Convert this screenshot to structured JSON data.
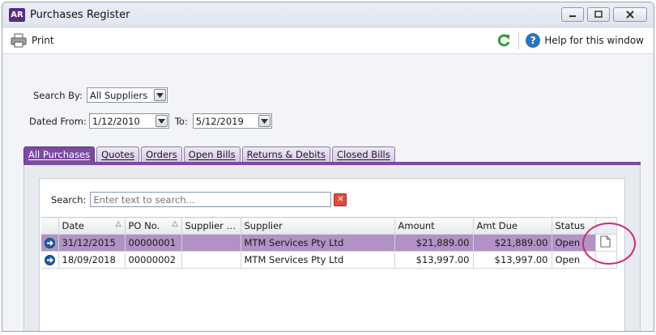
{
  "window": {
    "logo": "AR",
    "title": "Purchases Register"
  },
  "toolbar": {
    "print_label": "Print",
    "help_label": "Help for this window"
  },
  "filters": {
    "search_by_label": "Search By:",
    "search_by_value": "All Suppliers",
    "dated_from_label": "Dated From:",
    "dated_from_value": "1/12/2010",
    "to_label": "To:",
    "to_value": "5/12/2019"
  },
  "tabs": [
    {
      "label": "All Purchases",
      "active": true
    },
    {
      "label": "Quotes"
    },
    {
      "label": "Orders"
    },
    {
      "label": "Open Bills"
    },
    {
      "label": "Returns & Debits"
    },
    {
      "label": "Closed Bills"
    }
  ],
  "search": {
    "label": "Search:",
    "placeholder": "Enter text to search..."
  },
  "table": {
    "columns": [
      "Date",
      "PO No.",
      "Supplier I...",
      "Supplier",
      "Amount",
      "Amt Due",
      "Status"
    ],
    "rows": [
      {
        "date": "31/12/2015",
        "po": "00000001",
        "supplier_inv": "",
        "supplier": "MTM Services Pty Ltd",
        "amount": "$21,889.00",
        "amt_due": "$21,889.00",
        "status": "Open",
        "selected": true
      },
      {
        "date": "18/09/2018",
        "po": "00000002",
        "supplier_inv": "",
        "supplier": "MTM Services Pty Ltd",
        "amount": "$13,997.00",
        "amt_due": "$13,997.00",
        "status": "Open",
        "selected": false
      }
    ]
  },
  "colors": {
    "accent": "#7b4aa3",
    "selected_row": "#b093c4",
    "annotation": "#d0287a"
  }
}
